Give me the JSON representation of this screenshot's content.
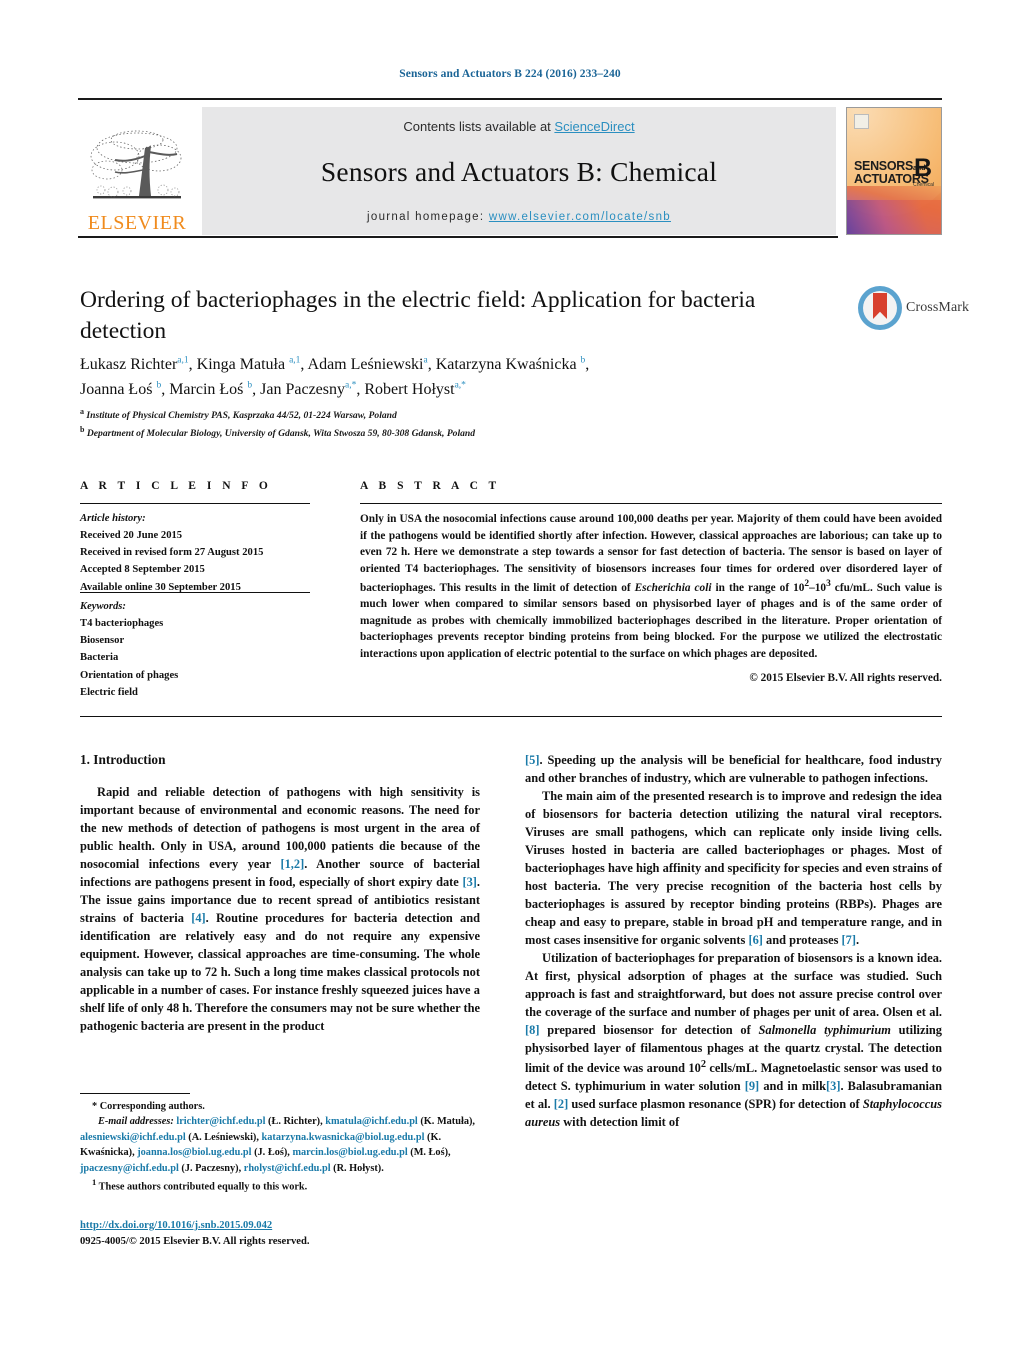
{
  "running_head": "Sensors and Actuators B 224 (2016) 233–240",
  "masthead": {
    "publisher_name": "ELSEVIER",
    "contents_prefix": "Contents lists available at ",
    "contents_link": "ScienceDirect",
    "journal_title": "Sensors and Actuators B: Chemical",
    "homepage_prefix": "journal homepage: ",
    "homepage_url": "www.elsevier.com/locate/snb",
    "cover": {
      "line1": "SENSORS",
      "line1_small": "and",
      "line2": "ACTUATORS",
      "letter": "B",
      "sublabel": "Chemical"
    }
  },
  "article": {
    "title": "Ordering of bacteriophages in the electric field: Application for bacteria detection",
    "crossmark_label": "CrossMark",
    "authors_line1": "Łukasz Richter<sup>a,1</sup>, Kinga Matuła <sup>a,1</sup>, Adam Leśniewski<sup>a</sup>, Katarzyna Kwaśnicka <sup>b</sup>,",
    "authors_line2": "Joanna Łoś <sup>b</sup>, Marcin Łoś <sup>b</sup>, Jan Paczesny<sup>a,*</sup>, Robert Hołyst<sup>a,*</sup>",
    "affiliation_a": "<sup>a</sup> Institute of Physical Chemistry PAS, Kasprzaka 44/52, 01-224 Warsaw, Poland",
    "affiliation_b": "<sup>b</sup> Department of Molecular Biology, University of Gdansk, Wita Stwosza 59, 80-308 Gdansk, Poland"
  },
  "article_info": {
    "heading": "A R T I C L E   I N F O",
    "history_label": "Article history:",
    "history": [
      "Received 20 June 2015",
      "Received in revised form 27 August 2015",
      "Accepted 8 September 2015",
      "Available online 30 September 2015"
    ],
    "keywords_label": "Keywords:",
    "keywords": [
      "T4 bacteriophages",
      "Biosensor",
      "Bacteria",
      "Orientation of phages",
      "Electric field"
    ]
  },
  "abstract": {
    "heading": "A B S T R A C T",
    "text_html": "Only in USA the nosocomial infections cause around 100,000 deaths per year. Majority of them could have been avoided if the pathogens would be identified shortly after infection. However, classical approaches are laborious; can take up to even 72 h. Here we demonstrate a step towards a sensor for fast detection of bacteria. The sensor is based on layer of oriented T4 bacteriophages. The sensitivity of biosensors increases four times for ordered over disordered layer of bacteriophages. This results in the limit of detection of <i>Escherichia coli</i> in the range of 10<sup>2</sup>–10<sup>3</sup> cfu/mL. Such value is much lower when compared to similar sensors based on physisorbed layer of phages and is of the same order of magnitude as probes with chemically immobilized bacteriophages described in the literature. Proper orientation of bacteriophages prevents receptor binding proteins from being blocked. For the purpose we utilized the electrostatic interactions upon application of electric potential to the surface on which phages are deposited.",
    "copyright": "© 2015 Elsevier B.V. All rights reserved."
  },
  "body": {
    "section_number_title": "1.  Introduction",
    "left_paragraphs_html": [
      "Rapid and reliable detection of pathogens with high sensitivity is important because of environmental and economic reasons. The need for the new methods of detection of pathogens is most urgent in the area of public health. Only in USA, around 100,000 patients die because of the nosocomial infections every year <span class=\"ref\">[1,2]</span>. Another source of bacterial infections are pathogens present in food, especially of short expiry date <span class=\"ref\">[3]</span>. The issue gains importance due to recent spread of antibiotics resistant strains of bacteria <span class=\"ref\">[4]</span>. Routine procedures for bacteria detection and identification are relatively easy and do not require any expensive equipment. However, classical approaches are time-consuming. The whole analysis can take up to 72 h. Such a long time makes classical protocols not applicable in a number of cases. For instance freshly squeezed juices have a shelf life of only 48 h. Therefore the consumers may not be sure whether the pathogenic bacteria are present in the product"
    ],
    "right_paragraphs_html": [
      "<span class=\"ref\">[5]</span>. Speeding up the analysis will be beneficial for healthcare, food industry and other branches of industry, which are vulnerable to pathogen infections.",
      "The main aim of the presented research is to improve and redesign the idea of biosensors for bacteria detection utilizing the natural viral receptors. Viruses are small pathogens, which can replicate only inside living cells. Viruses hosted in bacteria are called bacteriophages or phages. Most of bacteriophages have high affinity and specificity for species and even strains of host bacteria. The very precise recognition of the bacteria host cells by bacteriophages is assured by receptor binding proteins (RBPs). Phages are cheap and easy to prepare, stable in broad pH and temperature range, and in most cases insensitive for organic solvents <span class=\"ref\">[6]</span> and proteases <span class=\"ref\">[7]</span>.",
      "Utilization of bacteriophages for preparation of biosensors is a known idea. At first, physical adsorption of phages at the surface was studied. Such approach is fast and straightforward, but does not assure precise control over the coverage of the surface and number of phages per unit of area. Olsen et al. <span class=\"ref\">[8]</span> prepared biosensor for detection of <i>Salmonella typhimurium</i> utilizing physisorbed layer of filamentous phages at the quartz crystal. The detection limit of the device was around 10<sup>2</sup> cells/mL. Magnetoelastic sensor was used to detect S. typhimurium in water solution <span class=\"ref\">[9]</span> and in milk<span class=\"ref\">[3]</span>. Balasubramanian et al. <span class=\"ref\">[2]</span> used surface plasmon resonance (SPR) for detection of <i>Staphylococcus aureus</i> with detection limit of"
    ]
  },
  "footnotes": {
    "corresponding": "*  Corresponding authors.",
    "email_label": "E-mail addresses:",
    "emails_html": "<span class=\"mail\">lrichter@ichf.edu.pl</span> (Ł. Richter), <span class=\"mail\">kmatula@ichf.edu.pl</span> (K. Matuła), <span class=\"mail\">alesniewski@ichf.edu.pl</span> (A. Leśniewski), <span class=\"mail\">katarzyna.kwasnicka@biol.ug.edu.pl</span> (K. Kwaśnicka), <span class=\"mail\">joanna.los@biol.ug.edu.pl</span> (J. Łoś), <span class=\"mail\">marcin.los@biol.ug.edu.pl</span> (M. Łoś), <span class=\"mail\">jpaczesny@ichf.edu.pl</span> (J. Paczesny), <span class=\"mail\">rholyst@ichf.edu.pl</span> (R. Hołyst).",
    "equal_contribution": "<sup>1</sup>  These authors contributed equally to this work."
  },
  "doi_block": {
    "doi_url": "http://dx.doi.org/10.1016/j.snb.2015.09.042",
    "issn_copyright": "0925-4005/© 2015 Elsevier B.V. All rights reserved."
  },
  "colors": {
    "link": "#1a7aa8",
    "header_link": "#2b8fc0",
    "elsevier_orange": "#f08b1d",
    "masthead_bg": "#e7e7e8"
  }
}
